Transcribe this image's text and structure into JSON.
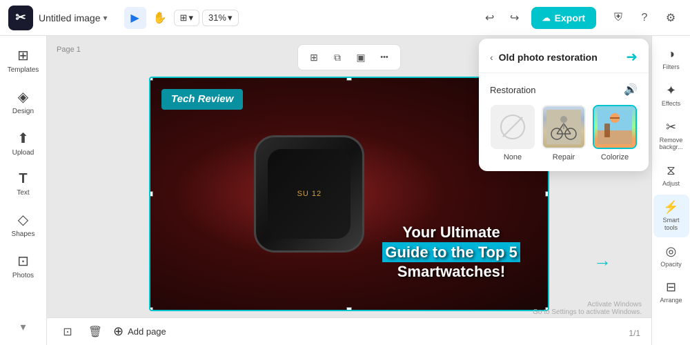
{
  "app": {
    "logo": "✂",
    "title": "Untitled image",
    "title_chevron": "▾"
  },
  "toolbar": {
    "select_tool": "▶",
    "hand_tool": "✋",
    "view_icon": "⊞",
    "zoom_level": "31%",
    "zoom_chevron": "▾",
    "undo": "↩",
    "redo": "↪",
    "export_label": "Export",
    "export_icon": "↑",
    "shield_icon": "⛨",
    "help_icon": "?",
    "settings_icon": "⚙"
  },
  "canvas_toolbar": {
    "grid_icon": "⊞",
    "layers_icon": "⧉",
    "frame_icon": "▣",
    "more_icon": "•••"
  },
  "sidebar": {
    "items": [
      {
        "id": "templates",
        "label": "Templates",
        "icon": "⊞"
      },
      {
        "id": "design",
        "label": "Design",
        "icon": "◈"
      },
      {
        "id": "upload",
        "label": "Upload",
        "icon": "⬆"
      },
      {
        "id": "text",
        "label": "Text",
        "icon": "T"
      },
      {
        "id": "shapes",
        "label": "Shapes",
        "icon": "◇"
      },
      {
        "id": "photos",
        "label": "Photos",
        "icon": "⊡"
      }
    ],
    "collapse_icon": "▾"
  },
  "canvas": {
    "page_label": "Page 1",
    "tech_review": "Tech Review",
    "headline_1": "Your Ultimate",
    "headline_2": "Guide to the Top 5",
    "headline_3": "Smartwatches!",
    "watch_time": "SU 12",
    "windows_watermark_1": "Activate Windows",
    "windows_watermark_2": "Go to Settings to activate Windows.",
    "page_indicator": "1/1"
  },
  "canvas_bottom": {
    "save_icon": "⊡",
    "delete_icon": "🗑",
    "add_page_icon": "⊕",
    "add_page_label": "Add page"
  },
  "right_panel": {
    "items": [
      {
        "id": "filters",
        "label": "Filters",
        "icon": "◑"
      },
      {
        "id": "effects",
        "label": "Effects",
        "icon": "✦"
      },
      {
        "id": "remove-bg",
        "label": "Remove backgr...",
        "icon": "✂"
      },
      {
        "id": "adjust",
        "label": "Adjust",
        "icon": "⧖"
      },
      {
        "id": "smart-tools",
        "label": "Smart tools",
        "icon": "⚡",
        "active": true
      },
      {
        "id": "opacity",
        "label": "Opacity",
        "icon": "◎"
      },
      {
        "id": "arrange",
        "label": "Arrange",
        "icon": "⊟"
      }
    ]
  },
  "restoration_popup": {
    "back_icon": "‹",
    "title": "Old photo restoration",
    "speaker_icon": "➜",
    "section_label": "Restoration",
    "sound_icon": "🔊",
    "options": [
      {
        "id": "none",
        "label": "None",
        "type": "none"
      },
      {
        "id": "repair",
        "label": "Repair",
        "type": "repair"
      },
      {
        "id": "colorize",
        "label": "Colorize",
        "type": "colorize",
        "selected": true
      }
    ]
  },
  "colors": {
    "accent": "#00c4cc",
    "primary_bg": "#fff",
    "sidebar_bg": "#fff",
    "canvas_bg": "#e8e8e8"
  }
}
